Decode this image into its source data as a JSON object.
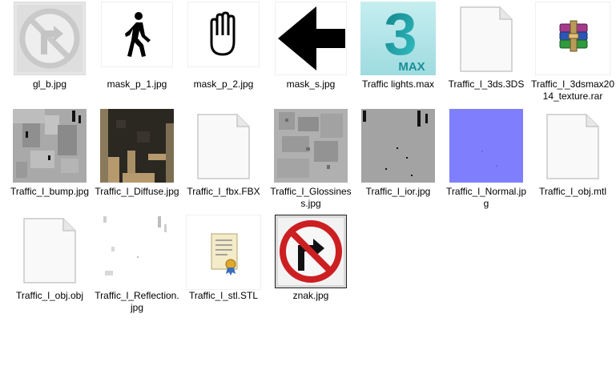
{
  "files": [
    {
      "name": "gl_b.jpg",
      "thumb_kind": "no-right-turn-faded-sign"
    },
    {
      "name": "mask_p_1.jpg",
      "thumb_kind": "pedestrian-mask"
    },
    {
      "name": "mask_p_2.jpg",
      "thumb_kind": "hand-mask"
    },
    {
      "name": "mask_s.jpg",
      "thumb_kind": "arrow-mask"
    },
    {
      "name": "Traffic lights.max",
      "thumb_kind": "3dsmax-icon",
      "icon_text": "MAX"
    },
    {
      "name": "Traffic_l_3ds.3DS",
      "thumb_kind": "blank-file"
    },
    {
      "name": "Traffic_l_3dsmax2014_texture.rar",
      "thumb_kind": "winrar-archive"
    },
    {
      "name": "Traffic_l_bump.jpg",
      "thumb_kind": "bump-texture"
    },
    {
      "name": "Traffic_l_Diffuse.jpg",
      "thumb_kind": "diffuse-texture"
    },
    {
      "name": "Traffic_l_fbx.FBX",
      "thumb_kind": "blank-file"
    },
    {
      "name": "Traffic_l_Glossiness.jpg",
      "thumb_kind": "glossiness-texture"
    },
    {
      "name": "Traffic_l_ior.jpg",
      "thumb_kind": "ior-texture"
    },
    {
      "name": "Traffic_l_Normal.jpg",
      "thumb_kind": "normal-map"
    },
    {
      "name": "Traffic_l_obj.mtl",
      "thumb_kind": "blank-file"
    },
    {
      "name": "Traffic_l_obj.obj",
      "thumb_kind": "blank-file"
    },
    {
      "name": "Traffic_l_Reflection.jpg",
      "thumb_kind": "reflection-texture"
    },
    {
      "name": "Traffic_l_stl.STL",
      "thumb_kind": "certificate-document"
    },
    {
      "name": "znak.jpg",
      "thumb_kind": "no-right-turn-sign"
    }
  ],
  "colors": {
    "sign_red": "#cc1f22",
    "normal_map": "#7f7ffe",
    "max_teal": "#1fb0b4",
    "diffuse_dark": "#2b2822",
    "diffuse_tan": "#b69a6e"
  }
}
